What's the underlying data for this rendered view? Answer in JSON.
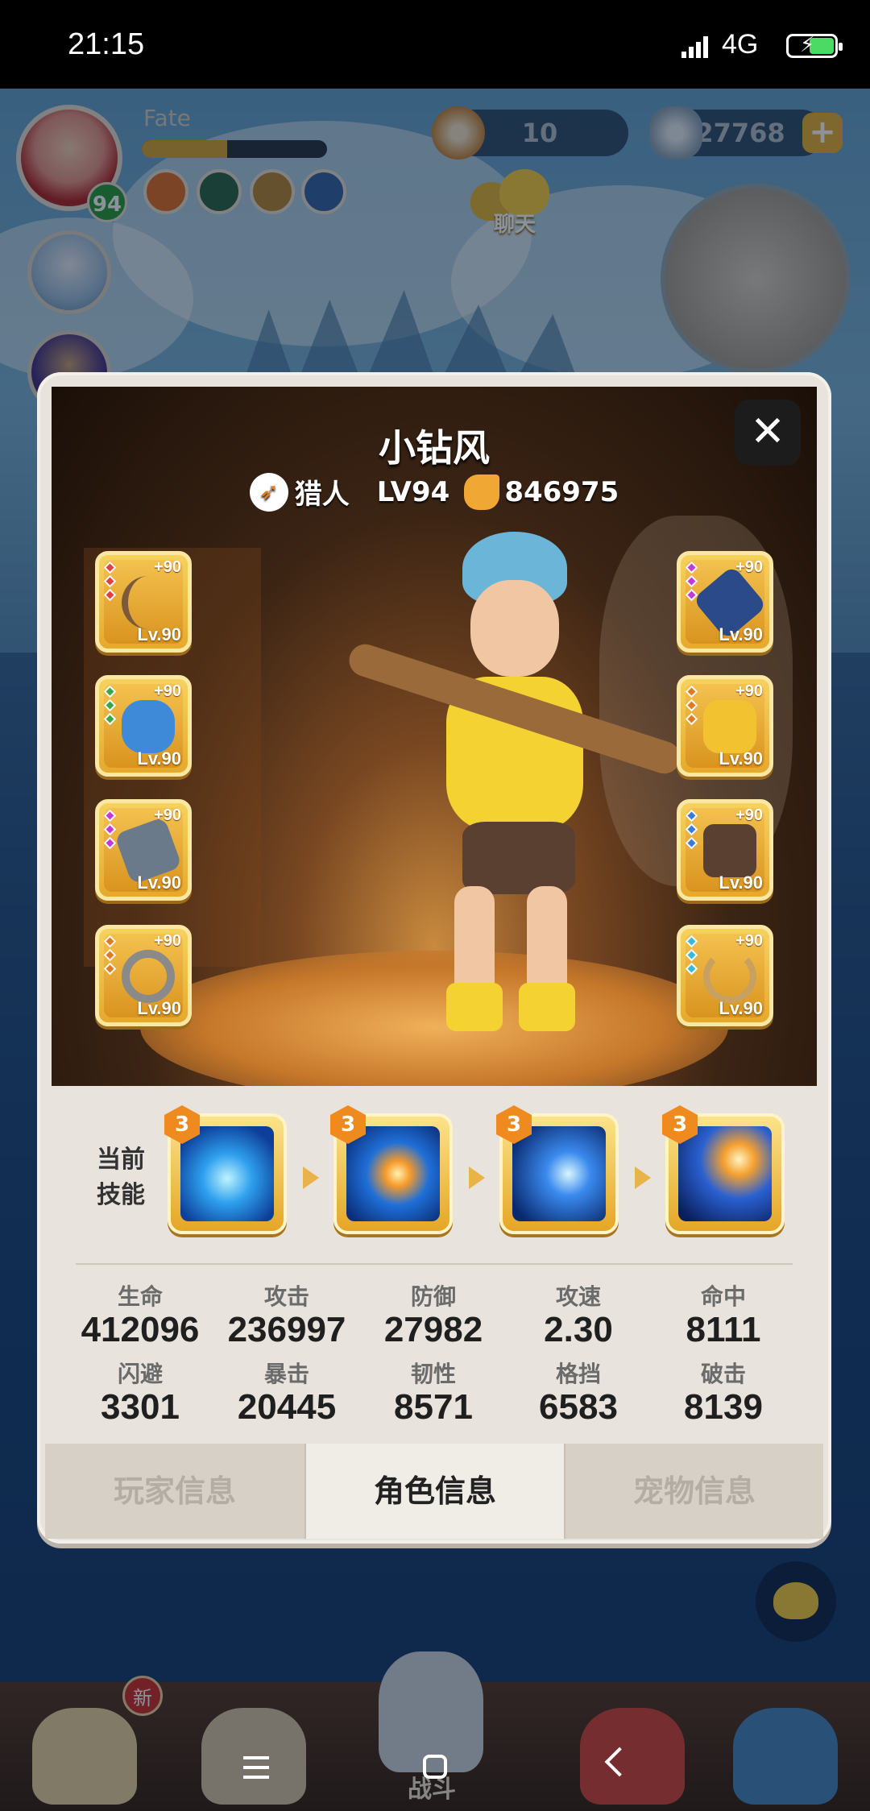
{
  "status_bar": {
    "time": "21:15",
    "network": "4G"
  },
  "hud": {
    "player_name": "Fate",
    "player_level": "94",
    "currency1_value": "10",
    "currency2_value": "27768",
    "chat_label": "聊天"
  },
  "character": {
    "name": "小钻风",
    "class_name": "猎人",
    "level": "LV94",
    "power": "846975"
  },
  "equipment": [
    {
      "plus": "+90",
      "level": "Lv.90",
      "item": "bow"
    },
    {
      "plus": "+90",
      "level": "Lv.90",
      "item": "pet-blue"
    },
    {
      "plus": "+90",
      "level": "Lv.90",
      "item": "claw"
    },
    {
      "plus": "+90",
      "level": "Lv.90",
      "item": "ring"
    },
    {
      "plus": "+90",
      "level": "Lv.90",
      "item": "arm-guard"
    },
    {
      "plus": "+90",
      "level": "Lv.90",
      "item": "armor"
    },
    {
      "plus": "+90",
      "level": "Lv.90",
      "item": "boots"
    },
    {
      "plus": "+90",
      "level": "Lv.90",
      "item": "necklace"
    }
  ],
  "skills": {
    "label_line1": "当前",
    "label_line2": "技能",
    "items": [
      {
        "level": "3"
      },
      {
        "level": "3"
      },
      {
        "level": "3"
      },
      {
        "level": "3"
      }
    ]
  },
  "stats": [
    {
      "label": "生命",
      "value": "412096"
    },
    {
      "label": "攻击",
      "value": "236997"
    },
    {
      "label": "防御",
      "value": "27982"
    },
    {
      "label": "攻速",
      "value": "2.30"
    },
    {
      "label": "命中",
      "value": "8111"
    },
    {
      "label": "闪避",
      "value": "3301"
    },
    {
      "label": "暴击",
      "value": "20445"
    },
    {
      "label": "韧性",
      "value": "8571"
    },
    {
      "label": "格挡",
      "value": "6583"
    },
    {
      "label": "破击",
      "value": "8139"
    }
  ],
  "tabs": [
    {
      "label": "玩家信息",
      "active": false
    },
    {
      "label": "角色信息",
      "active": true
    },
    {
      "label": "宠物信息",
      "active": false
    }
  ],
  "bottom_nav": {
    "new_badge": "新",
    "battle_label": "战斗"
  },
  "colors": {
    "accent_gold": "#e6a92b",
    "modal_bg": "#e8e3dc",
    "skill_blue": "#2ea0ee"
  }
}
